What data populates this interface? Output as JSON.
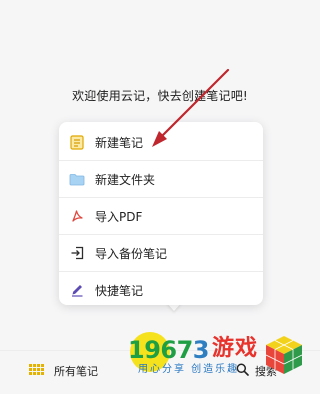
{
  "welcome_text": "欢迎使用云记，快去创建笔记吧!",
  "menu": {
    "items": [
      {
        "label": "新建笔记",
        "icon": "note-icon"
      },
      {
        "label": "新建文件夹",
        "icon": "folder-icon"
      },
      {
        "label": "导入PDF",
        "icon": "pdf-icon"
      },
      {
        "label": "导入备份笔记",
        "icon": "import-icon"
      },
      {
        "label": "快捷笔记",
        "icon": "pen-icon"
      }
    ]
  },
  "bottom_bar": {
    "all_notes_label": "所有笔记",
    "all_notes_icon": "grid-icon",
    "search_label": "搜索",
    "search_icon": "search-icon"
  },
  "watermark": {
    "number_part1": "1967",
    "number_part2": "3",
    "name": "游戏",
    "slogan": "用心分享 创造乐趣"
  },
  "colors": {
    "accent_yellow": "#e6b200",
    "arrow_red": "#c0262d",
    "folder_blue": "#8fc4ea",
    "pdf_red": "#e0473e",
    "pen_purple": "#5b4bb3"
  }
}
